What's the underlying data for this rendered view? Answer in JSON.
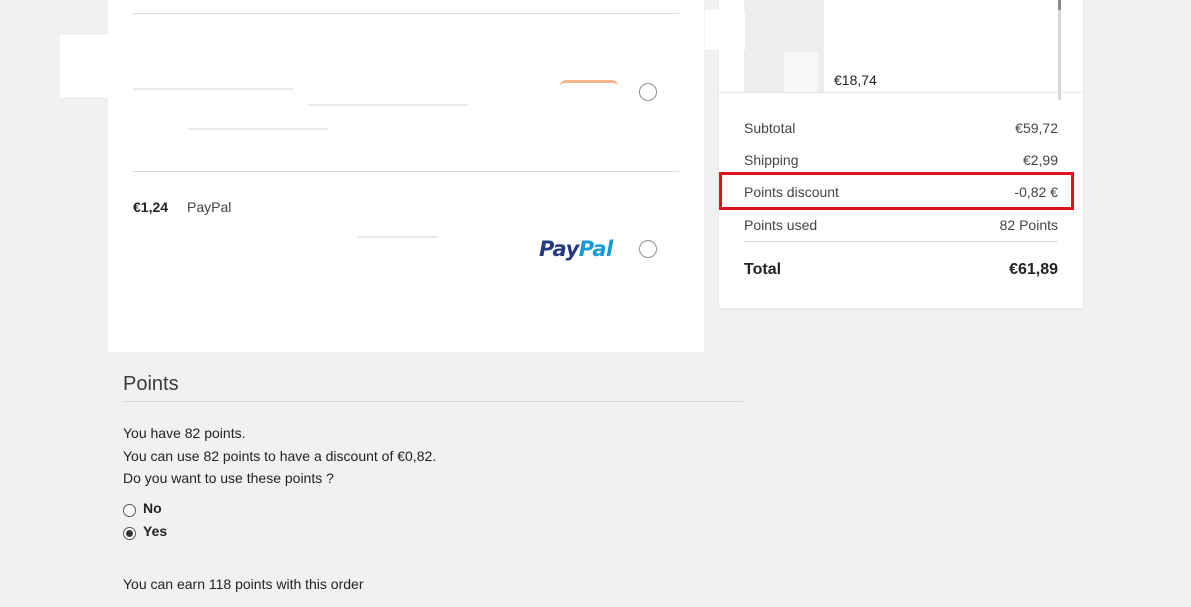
{
  "payment": {
    "paypal": {
      "price": "€1,24",
      "name": "PayPal",
      "logo_part1": "Pay",
      "logo_part2": "Pal"
    }
  },
  "summary": {
    "item_price": "€18,74",
    "rows": [
      {
        "label": "Subtotal",
        "value": "€59,72"
      },
      {
        "label": "Shipping",
        "value": "€2,99"
      },
      {
        "label": "Points discount",
        "value": "-0,82 €"
      },
      {
        "label": "Points used",
        "value": "82 Points"
      }
    ],
    "total": {
      "label": "Total",
      "value": "€61,89"
    }
  },
  "points": {
    "title": "Points",
    "have": "You have 82 points.",
    "use": "You can use 82 points to have a discount of €0,82.",
    "question": "Do you want to use these points ?",
    "options": [
      {
        "label": "No",
        "selected": false
      },
      {
        "label": "Yes",
        "selected": true
      }
    ],
    "earn": "You can earn 118 points with this order"
  },
  "colors": {
    "highlight": "#e0121b",
    "paypal_dark": "#253b80",
    "paypal_light": "#179bd7"
  }
}
